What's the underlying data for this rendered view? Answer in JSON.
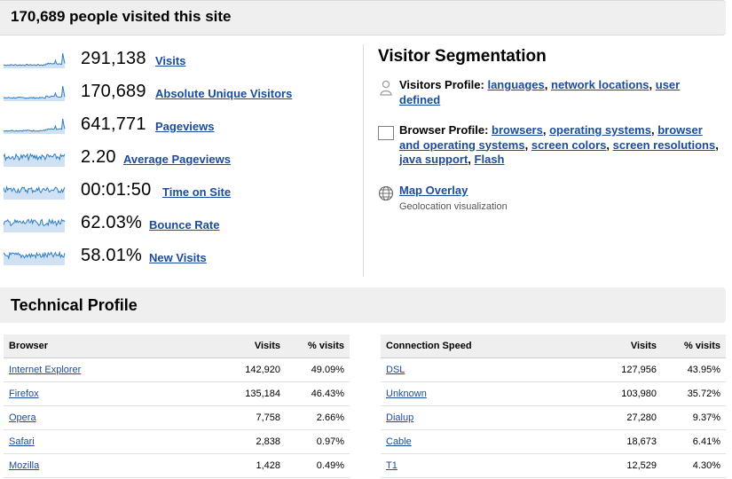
{
  "header": {
    "title": "170,689 people visited this site"
  },
  "metrics": [
    {
      "value": "291,138",
      "label": "Visits",
      "spark": "spike"
    },
    {
      "value": "170,689",
      "label": "Absolute Unique Visitors",
      "spark": "spike"
    },
    {
      "value": "641,771",
      "label": "Pageviews",
      "spark": "spike"
    },
    {
      "value": "2.20",
      "label": "Average Pageviews",
      "spark": "noisy"
    },
    {
      "value": "00:01:50",
      "label": "Time on Site",
      "spark": "noisy"
    },
    {
      "value": "62.03%",
      "label": "Bounce Rate",
      "spark": "noisy"
    },
    {
      "value": "58.01%",
      "label": "New Visits",
      "spark": "noisy"
    }
  ],
  "segmentation": {
    "title": "Visitor Segmentation",
    "visitors_profile": {
      "label": "Visitors Profile:",
      "links": [
        "languages",
        "network locations",
        "user defined"
      ]
    },
    "browser_profile": {
      "label": "Browser Profile:",
      "links": [
        "browsers",
        "operating systems",
        "browser and operating systems",
        "screen colors",
        "screen resolutions",
        "java support",
        "Flash"
      ]
    },
    "map_overlay": {
      "label": "Map Overlay",
      "description": "Geolocation visualization"
    }
  },
  "technical": {
    "title": "Technical Profile",
    "browser": {
      "headers": [
        "Browser",
        "Visits",
        "% visits"
      ],
      "rows": [
        [
          "Internet Explorer",
          "142,920",
          "49.09%"
        ],
        [
          "Firefox",
          "135,184",
          "46.43%"
        ],
        [
          "Opera",
          "7,758",
          "2.66%"
        ],
        [
          "Safari",
          "2,838",
          "0.97%"
        ],
        [
          "Mozilla",
          "1,428",
          "0.49%"
        ]
      ]
    },
    "connection": {
      "headers": [
        "Connection Speed",
        "Visits",
        "% visits"
      ],
      "rows": [
        [
          "DSL",
          "127,956",
          "43.95%"
        ],
        [
          "Unknown",
          "103,980",
          "35.72%"
        ],
        [
          "Dialup",
          "27,280",
          "9.37%"
        ],
        [
          "Cable",
          "18,673",
          "6.41%"
        ],
        [
          "T1",
          "12,529",
          "4.30%"
        ]
      ]
    }
  },
  "colors": {
    "link": "#1a4b9c",
    "spark_line": "#2e7dc4",
    "spark_fill": "#cfe1f3",
    "bar_bg": "#efefef"
  }
}
